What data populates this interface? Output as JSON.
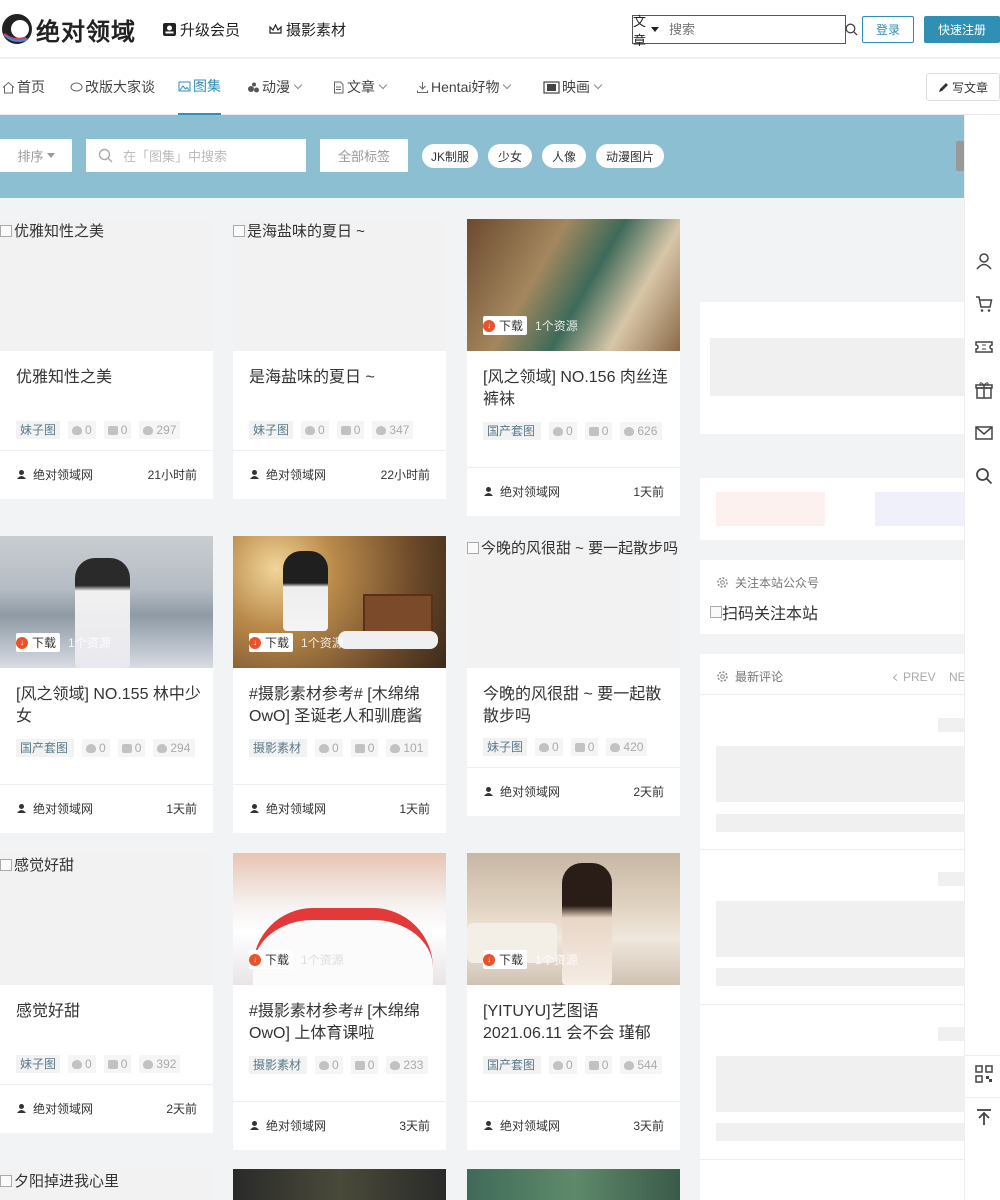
{
  "header": {
    "logo_text": "绝对领域",
    "nav_vip": "升级会员",
    "nav_material": "摄影素材",
    "search_select": "文章",
    "search_placeholder": "搜索",
    "login": "登录",
    "register": "快速注册"
  },
  "mainnav": {
    "items": [
      {
        "label": "首页",
        "icon": "home-icon"
      },
      {
        "label": "改版大家谈",
        "icon": "chat-icon"
      },
      {
        "label": "图集",
        "icon": "image-icon",
        "active": true
      },
      {
        "label": "动漫",
        "icon": "anime-icon",
        "dropdown": true
      },
      {
        "label": "文章",
        "icon": "doc-icon",
        "dropdown": true
      },
      {
        "label": "Hentai好物",
        "icon": "download-icon",
        "dropdown": true
      },
      {
        "label": "映画",
        "icon": "film-icon",
        "dropdown": true
      }
    ],
    "write": "写文章"
  },
  "filter": {
    "sort": "排序",
    "search_placeholder": "在「图集」中搜索",
    "all_tags": "全部标签",
    "tags": [
      "JK制服",
      "少女",
      "人像",
      "动漫图片"
    ]
  },
  "cards": [
    {
      "title": "优雅知性之美",
      "alt": "优雅知性之美",
      "cat": "妹子图",
      "likes": "0",
      "comments": "0",
      "views": "297",
      "author": "绝对领域网",
      "time": "21小时前",
      "photo": false
    },
    {
      "title": "是海盐味的夏日 ~",
      "alt": "是海盐味的夏日 ~",
      "cat": "妹子图",
      "likes": "0",
      "comments": "0",
      "views": "347",
      "author": "绝对领域网",
      "time": "22小时前",
      "photo": false
    },
    {
      "title": "[风之领域] NO.156 肉丝连裤袜",
      "cat": "国产套图",
      "likes": "0",
      "comments": "0",
      "views": "626",
      "author": "绝对领域网",
      "time": "1天前",
      "photo": true,
      "download": "下载",
      "resource": "1个资源"
    },
    {
      "title": "[风之领域] NO.155 林中少女",
      "cat": "国产套图",
      "likes": "0",
      "comments": "0",
      "views": "294",
      "author": "绝对领域网",
      "time": "1天前",
      "photo": true,
      "download": "下载",
      "resource": "1个资源"
    },
    {
      "title": "#摄影素材参考# [木绵绵OwO] 圣诞老人和驯鹿酱",
      "cat": "摄影素材",
      "likes": "0",
      "comments": "0",
      "views": "101",
      "author": "绝对领域网",
      "time": "1天前",
      "photo": true,
      "download": "下载",
      "resource": "1个资源"
    },
    {
      "title": "今晚的风很甜 ~ 要一起散散步吗",
      "alt": "今晚的风很甜 ~ 要一起散步吗",
      "cat": "妹子图",
      "likes": "0",
      "comments": "0",
      "views": "420",
      "author": "绝对领域网",
      "time": "2天前",
      "photo": false
    },
    {
      "title": "感觉好甜",
      "alt": "感觉好甜",
      "cat": "妹子图",
      "likes": "0",
      "comments": "0",
      "views": "392",
      "author": "绝对领域网",
      "time": "2天前",
      "photo": false
    },
    {
      "title": "#摄影素材参考# [木绵绵OwO] 上体育课啦",
      "cat": "摄影素材",
      "likes": "0",
      "comments": "0",
      "views": "233",
      "author": "绝对领域网",
      "time": "3天前",
      "photo": true,
      "download": "下载",
      "resource": "1个资源"
    },
    {
      "title": "[YITUYU]艺图语 2021.06.11 会不会 瑾郁",
      "cat": "国产套图",
      "likes": "0",
      "comments": "0",
      "views": "544",
      "author": "绝对领域网",
      "time": "3天前",
      "photo": true,
      "download": "下载",
      "resource": "1个资源"
    },
    {
      "alt": "夕阳掉进我心里",
      "photo": false
    }
  ],
  "sidebar": {
    "wechat_title": "关注本站公众号",
    "qr_alt": "扫码关注本站",
    "comments_title": "最新评论",
    "prev": "PREV",
    "next": "NE"
  },
  "colors": {
    "accent": "#2f8fb5",
    "filter_bg": "#8bbfd1",
    "download": "#e8532c"
  }
}
